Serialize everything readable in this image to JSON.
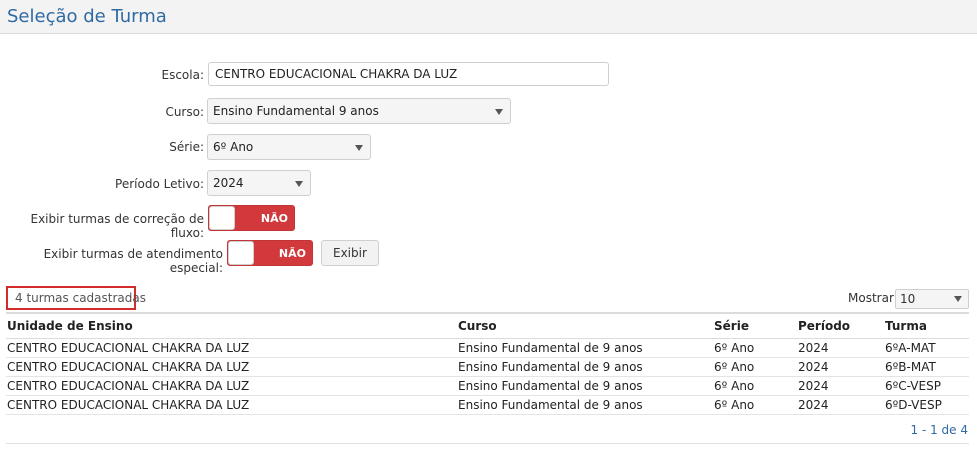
{
  "page": {
    "title": "Seleção de Turma"
  },
  "form": {
    "escola_label": "Escola:",
    "escola_value": "CENTRO EDUCACIONAL CHAKRA DA LUZ",
    "curso_label": "Curso:",
    "curso_value": "Ensino Fundamental 9 anos",
    "serie_label": "Série:",
    "serie_value": "6º Ano",
    "periodo_label": "Período Letivo:",
    "periodo_value": "2024",
    "correcao_label": "Exibir turmas de correção de fluxo:",
    "correcao_state": "NÃO",
    "especial_label": "Exibir turmas de atendimento especial:",
    "especial_state": "NÃO",
    "exibir_button": "Exibir"
  },
  "results": {
    "count_text": "4 turmas cadastradas",
    "mostrar_label": "Mostrar:",
    "mostrar_value": "10",
    "columns": [
      "Unidade de Ensino",
      "Curso",
      "Série",
      "Período",
      "Turma"
    ],
    "rows": [
      [
        "CENTRO EDUCACIONAL CHAKRA DA LUZ",
        "Ensino Fundamental de 9 anos",
        "6º Ano",
        "2024",
        "6ºA-MAT"
      ],
      [
        "CENTRO EDUCACIONAL CHAKRA DA LUZ",
        "Ensino Fundamental de 9 anos",
        "6º Ano",
        "2024",
        "6ºB-MAT"
      ],
      [
        "CENTRO EDUCACIONAL CHAKRA DA LUZ",
        "Ensino Fundamental de 9 anos",
        "6º Ano",
        "2024",
        "6ºC-VESP"
      ],
      [
        "CENTRO EDUCACIONAL CHAKRA DA LUZ",
        "Ensino Fundamental de 9 anos",
        "6º Ano",
        "2024",
        "6ºD-VESP"
      ]
    ],
    "pager_text": "1 - 1 de 4"
  },
  "colors": {
    "title": "#2f6aa3",
    "toggle_off": "#d2393c",
    "highlight": "#d42b2b"
  },
  "icons": {
    "dropdown": "chevron-down-icon"
  }
}
